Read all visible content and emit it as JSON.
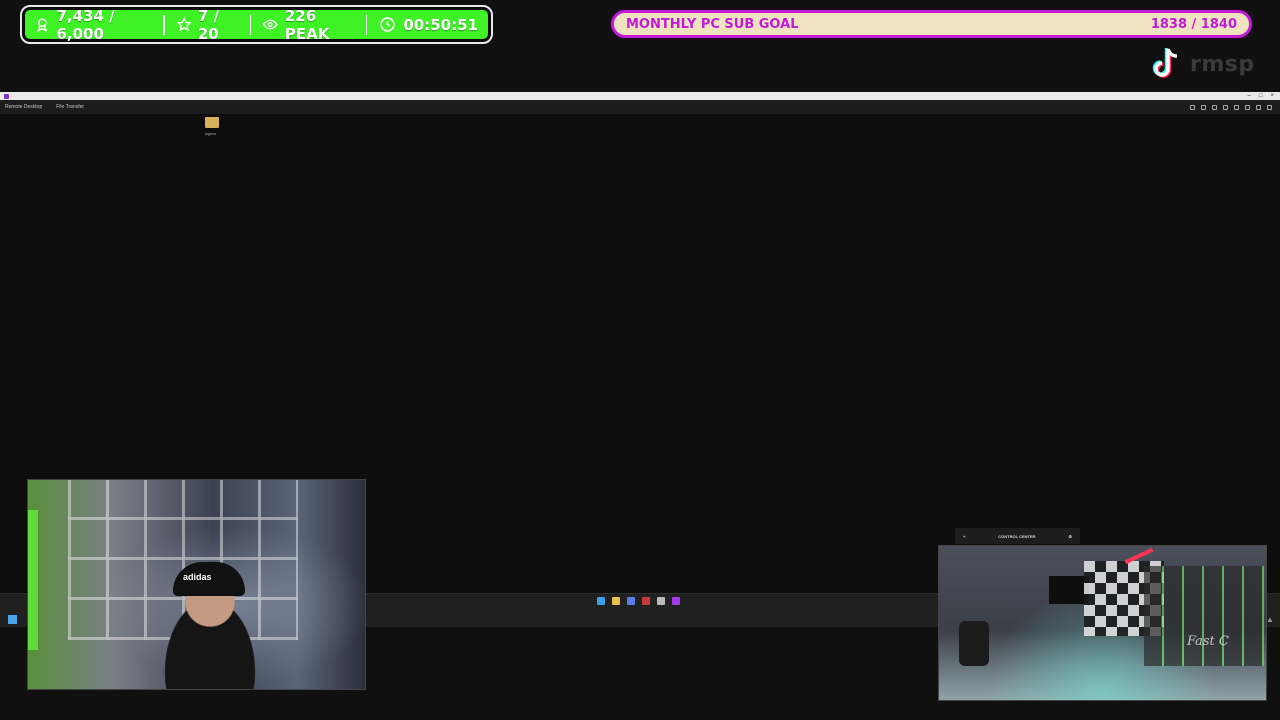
{
  "stats": {
    "followers": "7,434 / 6,000",
    "stars": "7 / 20",
    "viewers": "226 PEAK",
    "timer": "00:50:51",
    "bar_color": "#3ef226"
  },
  "goal": {
    "label": "MONTHLY PC SUB GOAL",
    "value": "1838 / 1840",
    "accent": "#c21bd6"
  },
  "brand": {
    "text": "rmsp"
  },
  "remote_window": {
    "tabs": [
      "Remote Desktop",
      "File Transfer"
    ],
    "desktop_icon_label": "sigma"
  },
  "cam_panel": {
    "title": "CONTROL CENTER",
    "plus": "+",
    "settings": "⚙"
  },
  "webcam_left": {
    "cap_logo": "adidas"
  },
  "webcam_right": {
    "sign_text": "Fast C"
  }
}
